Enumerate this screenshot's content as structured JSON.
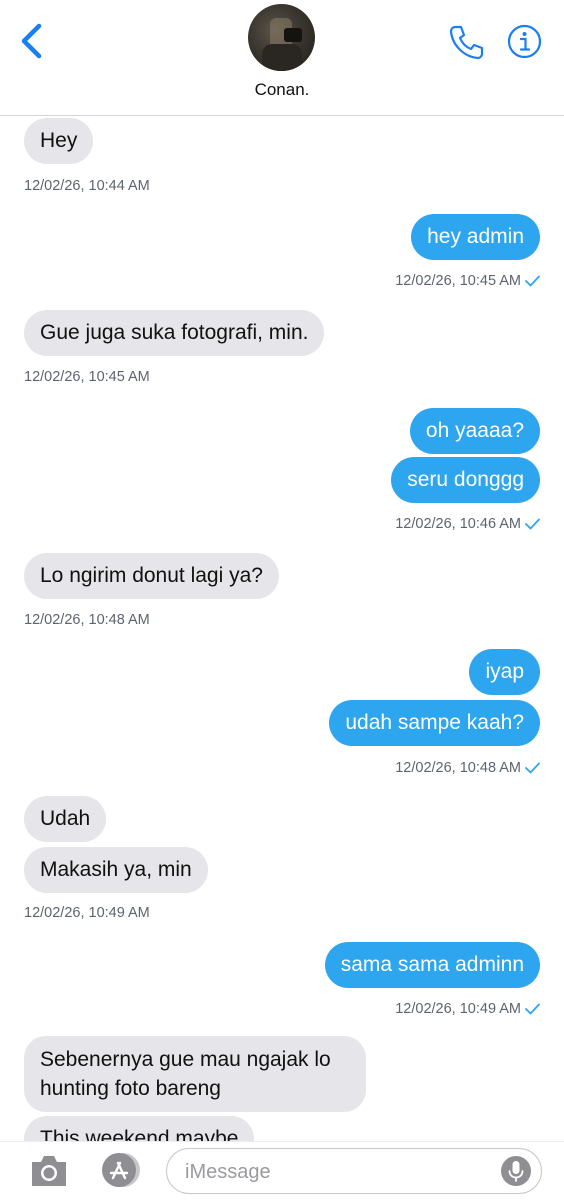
{
  "header": {
    "contact_name": "Conan."
  },
  "colors": {
    "accent": "#1a7ff0",
    "outgoing_bubble": "#2ea6ef",
    "incoming_bubble": "#e5e5ea",
    "timestamp": "#5d6470"
  },
  "icons": [
    "back-chevron-icon",
    "phone-icon",
    "info-icon",
    "check-icon",
    "camera-icon",
    "app-store-icon",
    "microphone-icon"
  ],
  "messages": [
    {
      "text": "Hey",
      "from": "contact"
    },
    {
      "text": "hey admin",
      "from": "me"
    },
    {
      "text": "Gue juga suka fotografi, min.",
      "from": "contact"
    },
    {
      "text": "oh yaaaa?",
      "from": "me"
    },
    {
      "text": "seru donggg",
      "from": "me"
    },
    {
      "text": "Lo ngirim donut lagi ya?",
      "from": "contact"
    },
    {
      "text": "iyap",
      "from": "me"
    },
    {
      "text": "udah sampe kaah?",
      "from": "me"
    },
    {
      "text": "Udah",
      "from": "contact"
    },
    {
      "text": "Makasih ya, min",
      "from": "contact"
    },
    {
      "text": "sama sama adminn",
      "from": "me"
    },
    {
      "text": "Sebenernya gue mau ngajak lo hunting foto bareng",
      "from": "contact"
    },
    {
      "text": "This weekend maybe",
      "from": "contact"
    }
  ],
  "timestamps": [
    {
      "text": "12/02/26, 10:44 AM",
      "from": "contact"
    },
    {
      "text": "12/02/26, 10:45 AM",
      "from": "me",
      "delivered": true
    },
    {
      "text": "12/02/26, 10:45 AM",
      "from": "contact"
    },
    {
      "text": "12/02/26, 10:46 AM",
      "from": "me",
      "delivered": true
    },
    {
      "text": "12/02/26, 10:48 AM",
      "from": "contact"
    },
    {
      "text": "12/02/26, 10:48 AM",
      "from": "me",
      "delivered": true
    },
    {
      "text": "12/02/26, 10:49 AM",
      "from": "contact"
    },
    {
      "text": "12/02/26, 10:49 AM",
      "from": "me",
      "delivered": true
    }
  ],
  "composer": {
    "placeholder": "iMessage",
    "value": ""
  }
}
